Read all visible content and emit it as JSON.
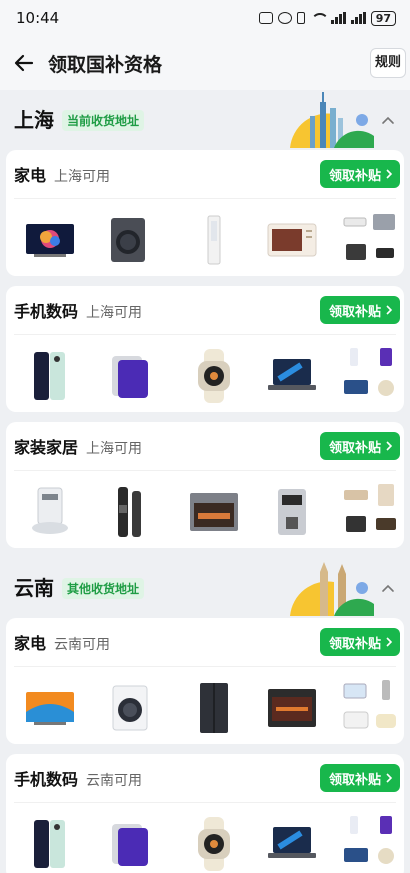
{
  "status": {
    "time": "10:44",
    "battery": "97"
  },
  "header": {
    "title": "领取国补资格",
    "rules": "规则"
  },
  "claim_label": "领取补贴",
  "regions": [
    {
      "name": "上海",
      "badge": "当前收货地址",
      "cards": [
        {
          "title": "家电",
          "subtitle": "上海可用",
          "products": [
            "tv-icon",
            "washing-machine-icon",
            "air-conditioner-icon",
            "microwave-icon",
            "appliance-bundle-icon"
          ]
        },
        {
          "title": "手机数码",
          "subtitle": "上海可用",
          "products": [
            "phone-icon",
            "tablet-icon",
            "smartwatch-icon",
            "laptop-icon",
            "digital-bundle-icon"
          ]
        },
        {
          "title": "家装家居",
          "subtitle": "上海可用",
          "products": [
            "robot-vacuum-icon",
            "smart-lock-icon",
            "oven-icon",
            "coffee-machine-icon",
            "home-bundle-icon"
          ]
        }
      ]
    },
    {
      "name": "云南",
      "badge": "其他收货地址",
      "cards": [
        {
          "title": "家电",
          "subtitle": "云南可用",
          "products": [
            "tv-icon",
            "washing-machine-icon",
            "refrigerator-icon",
            "oven-icon",
            "appliance-bundle-icon"
          ]
        },
        {
          "title": "手机数码",
          "subtitle": "云南可用",
          "products": [
            "phone-icon",
            "tablet-icon",
            "smartwatch-icon",
            "laptop-icon",
            "digital-bundle-icon"
          ]
        }
      ]
    }
  ],
  "colors": {
    "accent": "#18b74c",
    "badge_bg": "#dff4e5",
    "badge_text": "#1f9d45",
    "background": "#eef0f3"
  }
}
